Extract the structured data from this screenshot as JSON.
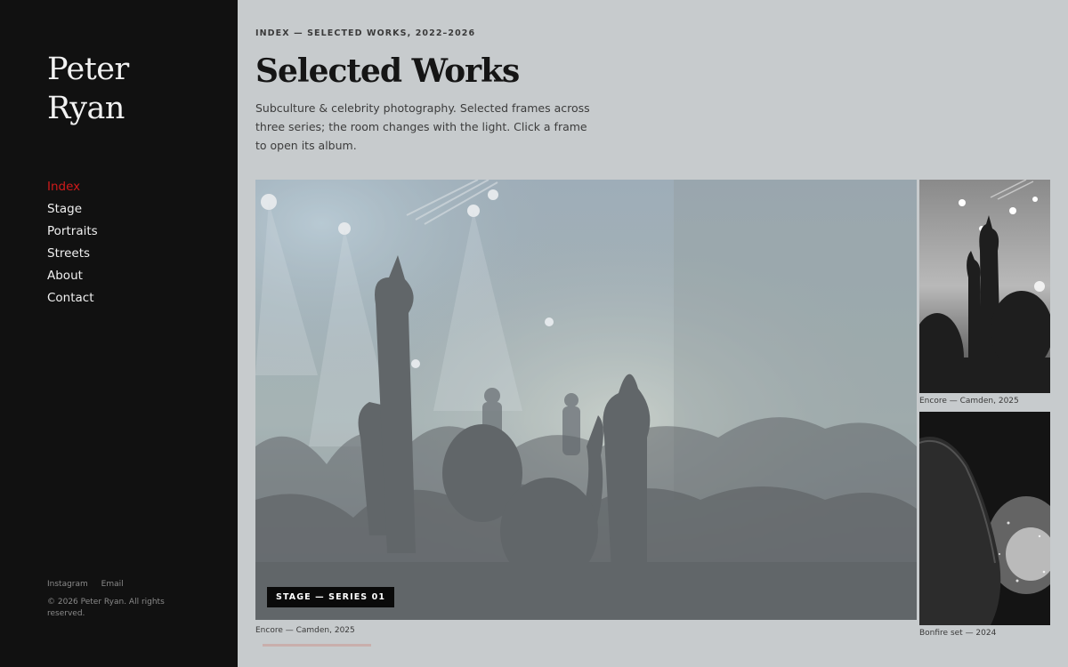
{
  "sidebar": {
    "brand_line1": "Peter",
    "brand_line2": "Ryan",
    "nav": [
      {
        "label": "Index",
        "active": true
      },
      {
        "label": "Stage",
        "active": false
      },
      {
        "label": "Portraits",
        "active": false
      },
      {
        "label": "Streets",
        "active": false
      },
      {
        "label": "About",
        "active": false
      },
      {
        "label": "Contact",
        "active": false
      }
    ],
    "links": [
      "Instagram",
      "Email"
    ],
    "copyright": "© 2026 Peter Ryan. All rights reserved."
  },
  "header": {
    "eyebrow": "INDEX — SELECTED WORKS, 2022–2026",
    "title": "Selected Works",
    "intro": "Subculture & celebrity photography. Selected frames across three series; the room changes with the light. Click a frame to open its album."
  },
  "gallery": {
    "featured": {
      "badge": "STAGE — SERIES 01",
      "caption": "Encore — Camden, 2025"
    },
    "thumbs": [
      {
        "caption": "Encore — Camden, 2025"
      },
      {
        "caption": "Bonfire set — 2024"
      }
    ]
  },
  "colors": {
    "sidebar_bg": "#111111",
    "page_bg": "#c7cbcd",
    "accent": "#d01b1b"
  }
}
